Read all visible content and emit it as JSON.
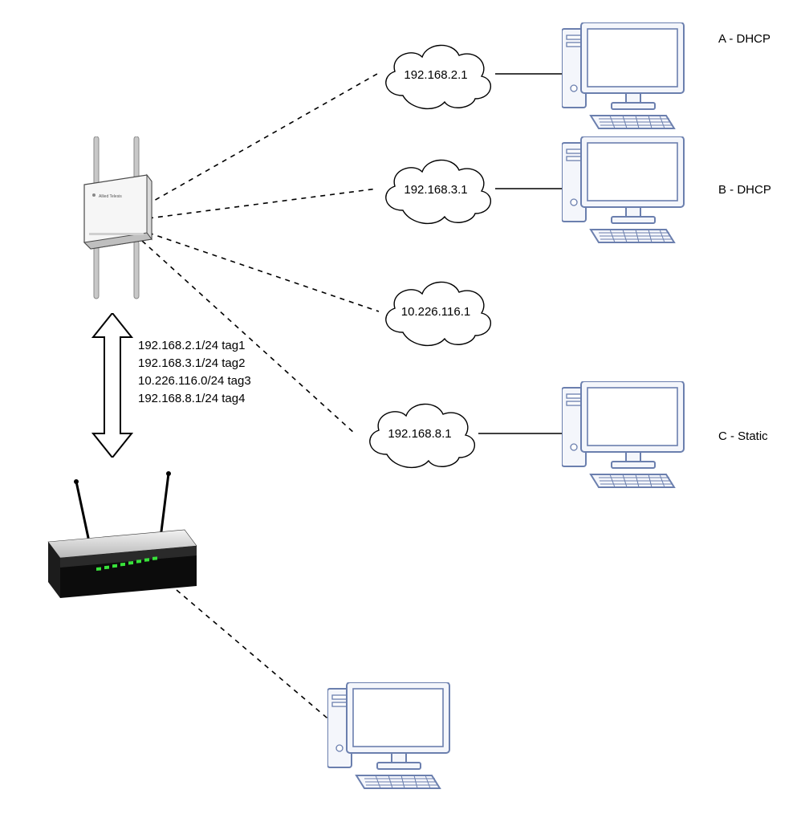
{
  "clouds": {
    "a": {
      "ip": "192.168.2.1"
    },
    "b": {
      "ip": "192.168.3.1"
    },
    "c": {
      "ip": "10.226.116.1"
    },
    "d": {
      "ip": "192.168.8.1"
    }
  },
  "hosts": {
    "a": {
      "label": "A - DHCP"
    },
    "b": {
      "label": "B - DHCP"
    },
    "c": {
      "label": "C - Static"
    }
  },
  "vlan_list": {
    "line1": "192.168.2.1/24 tag1",
    "line2": "192.168.3.1/24 tag2",
    "line3": "10.226.116.0/24 tag3",
    "line4": "192.168.8.1/24 tag4"
  },
  "ap": {
    "brand": "Allied Telesis"
  }
}
